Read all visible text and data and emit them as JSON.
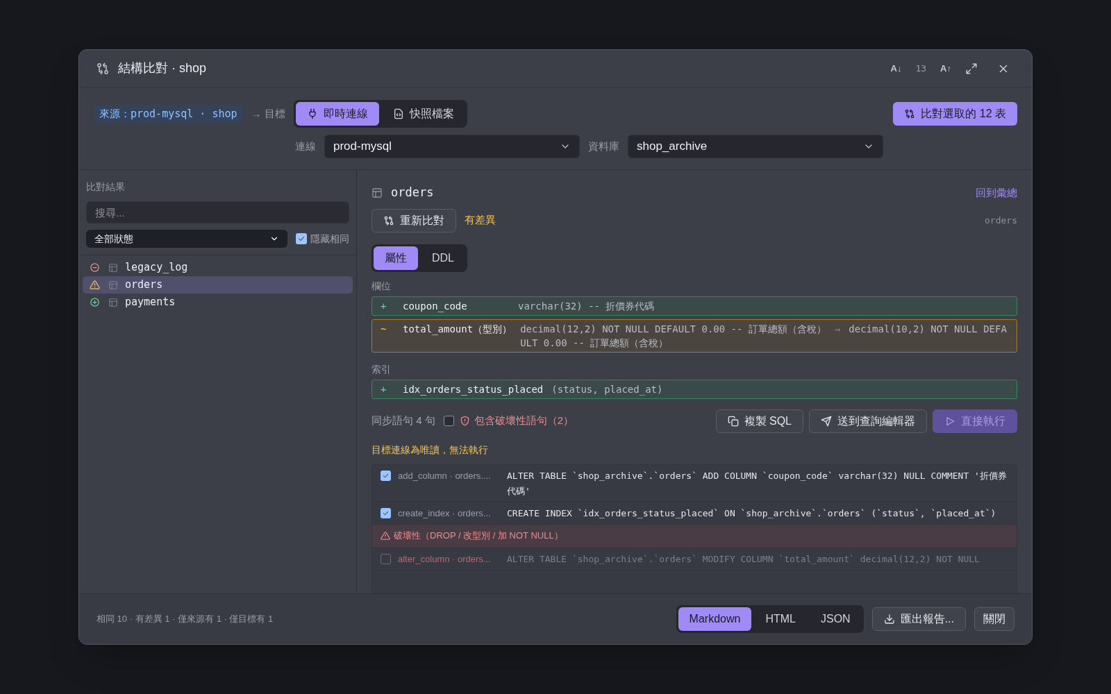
{
  "dialog": {
    "title": "結構比對 · shop",
    "font_decrease": "A↓",
    "font_size": "13",
    "font_increase": "A↑"
  },
  "source": {
    "badge": "來源：prod-mysql · shop",
    "target_label": "→ 目標"
  },
  "mode_tabs": [
    {
      "label": "即時連線",
      "selected": true
    },
    {
      "label": "快照檔案",
      "selected": false
    }
  ],
  "compare_button": "比對選取的 12 表",
  "connection": {
    "label": "連線",
    "value": "prod-mysql"
  },
  "database": {
    "label": "資料庫",
    "value": "shop_archive"
  },
  "results": {
    "title": "比對結果",
    "search_placeholder": "搜尋...",
    "filter": "全部狀態",
    "hide_same": {
      "label": "隱藏相同",
      "checked": true
    },
    "items": [
      {
        "name": "legacy_log",
        "kind": "removed",
        "selected": false
      },
      {
        "name": "orders",
        "kind": "changed",
        "selected": true
      },
      {
        "name": "payments",
        "kind": "added",
        "selected": false
      }
    ]
  },
  "detail": {
    "table": "orders",
    "back_link": "回到彙總",
    "recompare": "重新比對",
    "status_text": "有差異",
    "side_label": "orders",
    "view_tabs": [
      {
        "label": "屬性",
        "selected": true
      },
      {
        "label": "DDL",
        "selected": false
      }
    ],
    "sections": [
      {
        "title": "欄位",
        "rows": [
          {
            "kind": "added",
            "sign": "+",
            "name": "coupon_code",
            "definition": "varchar(32) -- 折價券代碼"
          },
          {
            "kind": "changed",
            "sign": "~",
            "name": "total_amount（型別）",
            "definition": "decimal(12,2) NOT NULL DEFAULT 0.00 -- 訂單總額（含稅）",
            "arrow": "→",
            "new_definition": "decimal(10,2) NOT NULL DEFAULT 0.00 -- 訂單總額（含稅）"
          }
        ]
      },
      {
        "title": "索引",
        "rows": [
          {
            "kind": "added",
            "sign": "+",
            "name": "idx_orders_status_placed",
            "definition": "(status, placed_at)"
          }
        ]
      }
    ]
  },
  "sync": {
    "count_label": "同步語句 4 句",
    "destructive": {
      "checked": false,
      "label": "包含破壞性語句（2）"
    },
    "buttons": [
      {
        "label": "複製 SQL",
        "kind": "copy",
        "disabled": false
      },
      {
        "label": "送到查詢編輯器",
        "kind": "send",
        "disabled": false
      },
      {
        "label": "直接執行",
        "kind": "run",
        "disabled": true
      }
    ],
    "warning": "目標連線為唯讀，無法執行",
    "statements": [
      {
        "kind": "statement",
        "checked": true,
        "label": "add_column · orders....",
        "sql": "ALTER TABLE `shop_archive`.`orders` ADD COLUMN `coupon_code` varchar(32) NULL COMMENT '折價券代碼'"
      },
      {
        "kind": "statement",
        "checked": true,
        "label": "create_index · orders...",
        "sql": "CREATE INDEX `idx_orders_status_placed` ON `shop_archive`.`orders` (`status`, `placed_at`)"
      },
      {
        "kind": "group",
        "label": "破壞性（DROP / 改型別 / 加 NOT NULL）"
      },
      {
        "kind": "destructive",
        "checked": false,
        "label": "alter_column · orders...",
        "sql": "ALTER TABLE `shop_archive`.`orders` MODIFY COLUMN `total_amount` decimal(12,2) NOT NULL"
      }
    ]
  },
  "footer": {
    "summary": "相同 10 · 有差異 1 · 僅來源有 1 · 僅目標有 1",
    "formats": [
      {
        "label": "Markdown",
        "selected": true
      },
      {
        "label": "HTML",
        "selected": false
      },
      {
        "label": "JSON",
        "selected": false
      }
    ],
    "export": "匯出報告...",
    "close": "關閉"
  }
}
